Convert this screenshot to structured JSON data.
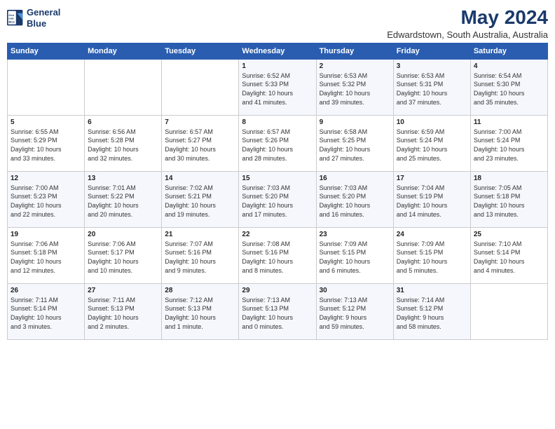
{
  "logo": {
    "line1": "General",
    "line2": "Blue"
  },
  "title": "May 2024",
  "subtitle": "Edwardstown, South Australia, Australia",
  "days_of_week": [
    "Sunday",
    "Monday",
    "Tuesday",
    "Wednesday",
    "Thursday",
    "Friday",
    "Saturday"
  ],
  "weeks": [
    [
      {
        "day": "",
        "content": ""
      },
      {
        "day": "",
        "content": ""
      },
      {
        "day": "",
        "content": ""
      },
      {
        "day": "1",
        "content": "Sunrise: 6:52 AM\nSunset: 5:33 PM\nDaylight: 10 hours\nand 41 minutes."
      },
      {
        "day": "2",
        "content": "Sunrise: 6:53 AM\nSunset: 5:32 PM\nDaylight: 10 hours\nand 39 minutes."
      },
      {
        "day": "3",
        "content": "Sunrise: 6:53 AM\nSunset: 5:31 PM\nDaylight: 10 hours\nand 37 minutes."
      },
      {
        "day": "4",
        "content": "Sunrise: 6:54 AM\nSunset: 5:30 PM\nDaylight: 10 hours\nand 35 minutes."
      }
    ],
    [
      {
        "day": "5",
        "content": "Sunrise: 6:55 AM\nSunset: 5:29 PM\nDaylight: 10 hours\nand 33 minutes."
      },
      {
        "day": "6",
        "content": "Sunrise: 6:56 AM\nSunset: 5:28 PM\nDaylight: 10 hours\nand 32 minutes."
      },
      {
        "day": "7",
        "content": "Sunrise: 6:57 AM\nSunset: 5:27 PM\nDaylight: 10 hours\nand 30 minutes."
      },
      {
        "day": "8",
        "content": "Sunrise: 6:57 AM\nSunset: 5:26 PM\nDaylight: 10 hours\nand 28 minutes."
      },
      {
        "day": "9",
        "content": "Sunrise: 6:58 AM\nSunset: 5:25 PM\nDaylight: 10 hours\nand 27 minutes."
      },
      {
        "day": "10",
        "content": "Sunrise: 6:59 AM\nSunset: 5:24 PM\nDaylight: 10 hours\nand 25 minutes."
      },
      {
        "day": "11",
        "content": "Sunrise: 7:00 AM\nSunset: 5:24 PM\nDaylight: 10 hours\nand 23 minutes."
      }
    ],
    [
      {
        "day": "12",
        "content": "Sunrise: 7:00 AM\nSunset: 5:23 PM\nDaylight: 10 hours\nand 22 minutes."
      },
      {
        "day": "13",
        "content": "Sunrise: 7:01 AM\nSunset: 5:22 PM\nDaylight: 10 hours\nand 20 minutes."
      },
      {
        "day": "14",
        "content": "Sunrise: 7:02 AM\nSunset: 5:21 PM\nDaylight: 10 hours\nand 19 minutes."
      },
      {
        "day": "15",
        "content": "Sunrise: 7:03 AM\nSunset: 5:20 PM\nDaylight: 10 hours\nand 17 minutes."
      },
      {
        "day": "16",
        "content": "Sunrise: 7:03 AM\nSunset: 5:20 PM\nDaylight: 10 hours\nand 16 minutes."
      },
      {
        "day": "17",
        "content": "Sunrise: 7:04 AM\nSunset: 5:19 PM\nDaylight: 10 hours\nand 14 minutes."
      },
      {
        "day": "18",
        "content": "Sunrise: 7:05 AM\nSunset: 5:18 PM\nDaylight: 10 hours\nand 13 minutes."
      }
    ],
    [
      {
        "day": "19",
        "content": "Sunrise: 7:06 AM\nSunset: 5:18 PM\nDaylight: 10 hours\nand 12 minutes."
      },
      {
        "day": "20",
        "content": "Sunrise: 7:06 AM\nSunset: 5:17 PM\nDaylight: 10 hours\nand 10 minutes."
      },
      {
        "day": "21",
        "content": "Sunrise: 7:07 AM\nSunset: 5:16 PM\nDaylight: 10 hours\nand 9 minutes."
      },
      {
        "day": "22",
        "content": "Sunrise: 7:08 AM\nSunset: 5:16 PM\nDaylight: 10 hours\nand 8 minutes."
      },
      {
        "day": "23",
        "content": "Sunrise: 7:09 AM\nSunset: 5:15 PM\nDaylight: 10 hours\nand 6 minutes."
      },
      {
        "day": "24",
        "content": "Sunrise: 7:09 AM\nSunset: 5:15 PM\nDaylight: 10 hours\nand 5 minutes."
      },
      {
        "day": "25",
        "content": "Sunrise: 7:10 AM\nSunset: 5:14 PM\nDaylight: 10 hours\nand 4 minutes."
      }
    ],
    [
      {
        "day": "26",
        "content": "Sunrise: 7:11 AM\nSunset: 5:14 PM\nDaylight: 10 hours\nand 3 minutes."
      },
      {
        "day": "27",
        "content": "Sunrise: 7:11 AM\nSunset: 5:13 PM\nDaylight: 10 hours\nand 2 minutes."
      },
      {
        "day": "28",
        "content": "Sunrise: 7:12 AM\nSunset: 5:13 PM\nDaylight: 10 hours\nand 1 minute."
      },
      {
        "day": "29",
        "content": "Sunrise: 7:13 AM\nSunset: 5:13 PM\nDaylight: 10 hours\nand 0 minutes."
      },
      {
        "day": "30",
        "content": "Sunrise: 7:13 AM\nSunset: 5:12 PM\nDaylight: 9 hours\nand 59 minutes."
      },
      {
        "day": "31",
        "content": "Sunrise: 7:14 AM\nSunset: 5:12 PM\nDaylight: 9 hours\nand 58 minutes."
      },
      {
        "day": "",
        "content": ""
      }
    ]
  ]
}
